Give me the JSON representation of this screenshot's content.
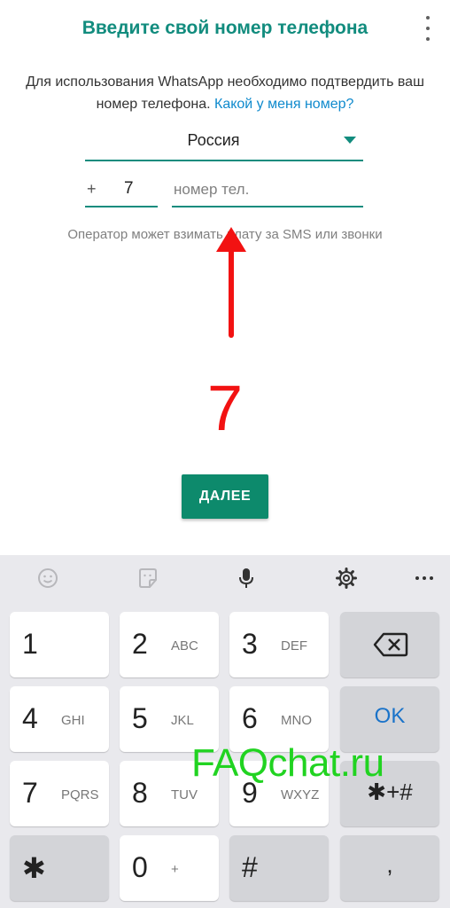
{
  "header": {
    "title": "Введите свой номер телефона"
  },
  "description": {
    "line_text": "Для использования WhatsApp необходимо подтвердить ваш номер телефона.",
    "link": "Какой у меня номер?"
  },
  "country": {
    "name": "Россия"
  },
  "phone": {
    "plus": "+",
    "country_code": "7",
    "placeholder": "номер тел.",
    "value": ""
  },
  "operator_note": "Оператор может взимать плату за SMS или звонки",
  "annotation": {
    "big_number": "7",
    "color": "#f21212"
  },
  "next_button": {
    "label": "ДАЛЕЕ"
  },
  "colors": {
    "accent": "#128c7e",
    "button": "#0d8a6c",
    "link": "#0f8acd",
    "keyboard_bg": "#e9e9ed"
  },
  "keyboard": {
    "toolbar": [
      "smiley-icon",
      "sticker-icon",
      "microphone-icon",
      "gear-icon",
      "more-icon"
    ],
    "keys": [
      {
        "main": "1",
        "sub": ""
      },
      {
        "main": "2",
        "sub": "ABC"
      },
      {
        "main": "3",
        "sub": "DEF"
      },
      {
        "main": "4",
        "sub": "GHI"
      },
      {
        "main": "5",
        "sub": "JKL"
      },
      {
        "main": "6",
        "sub": "MNO"
      },
      {
        "main": "7",
        "sub": "PQRS"
      },
      {
        "main": "8",
        "sub": "TUV"
      },
      {
        "main": "9",
        "sub": "WXYZ"
      },
      {
        "main": "✱",
        "sub": ""
      },
      {
        "main": "0",
        "sub": "+"
      },
      {
        "main": "#",
        "sub": ""
      }
    ],
    "ok_label": "OK",
    "symbols_label": "✱+#",
    "comma_label": ","
  },
  "watermark": "FAQchat.ru"
}
